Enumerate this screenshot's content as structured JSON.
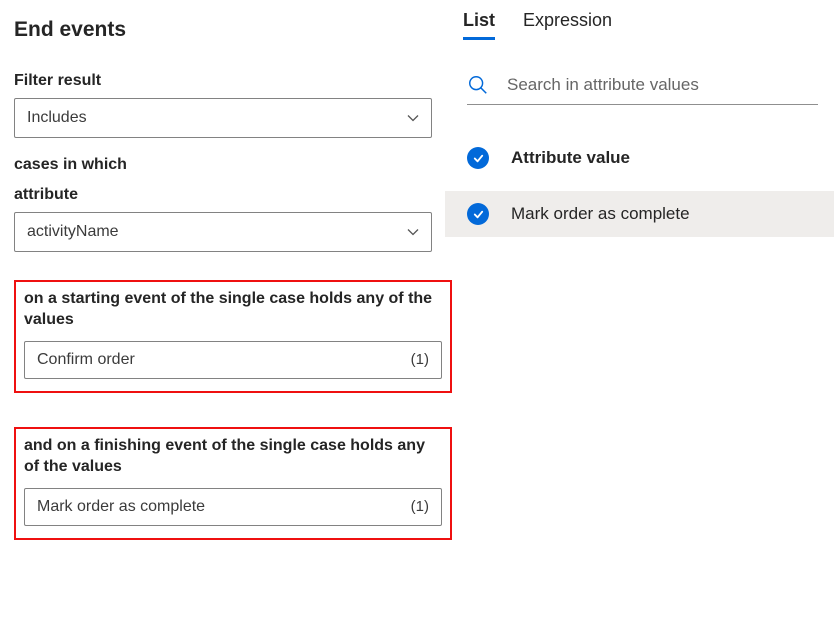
{
  "title": "End events",
  "left": {
    "filter_result_label": "Filter result",
    "filter_result_value": "Includes",
    "cases_label": "cases in which",
    "attribute_label": "attribute",
    "attribute_value": "activityName",
    "start_label": "on a starting event of the single case holds any of the values",
    "start_value": "Confirm order",
    "start_count": "(1)",
    "finish_label": "and on a finishing event of the single case holds any of the values",
    "finish_value": "Mark order as complete",
    "finish_count": "(1)"
  },
  "right": {
    "tabs": {
      "list": "List",
      "expression": "Expression"
    },
    "search_placeholder": "Search in attribute values",
    "header_label": "Attribute value",
    "items": [
      {
        "label": "Mark order as complete"
      }
    ]
  }
}
